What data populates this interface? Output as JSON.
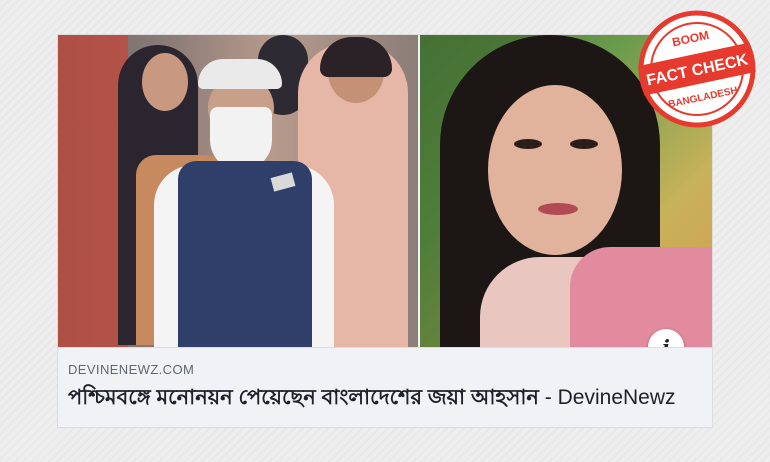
{
  "post": {
    "domain": "DEVINENEWZ.COM",
    "headline": "পশ্চিমবঙ্গে মনোনয়ন পেয়েছেন বাংলাদেশের জয়া আহসান",
    "separator": " - ",
    "source": "DevineNewz"
  },
  "info_button": {
    "label": "i"
  },
  "stamp": {
    "top_text": "BOOM",
    "center_text": "FACT CHECK",
    "bottom_text": "BANGLADESH",
    "color": "#e63a2e"
  },
  "icons": [
    "info-icon",
    "fact-check-stamp"
  ]
}
